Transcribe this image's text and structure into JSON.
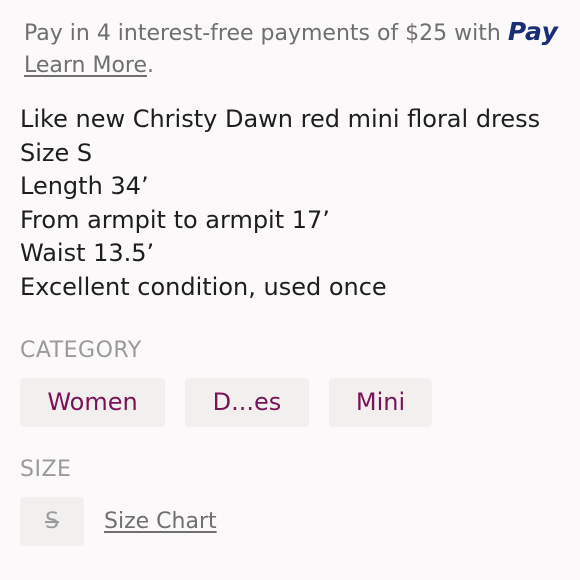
{
  "payment": {
    "text": "Pay in 4 interest-free payments of $25 with ",
    "brand": "Pay",
    "learn_more": "Learn More",
    "learn_suffix": ".",
    "brand_color": "#1a2e78"
  },
  "description": {
    "lines": [
      "Like new Christy Dawn red mini floral dress",
      "Size S",
      "Length 34’",
      "From armpit to armpit 17’",
      "Waist 13.5’",
      "Excellent condition, used once"
    ]
  },
  "category": {
    "label": "CATEGORY",
    "chips": [
      "Women",
      "D...es",
      "Mini"
    ],
    "chip_text_color": "#7a1257"
  },
  "size": {
    "label": "SIZE",
    "value": "S",
    "size_chart": "Size Chart"
  }
}
